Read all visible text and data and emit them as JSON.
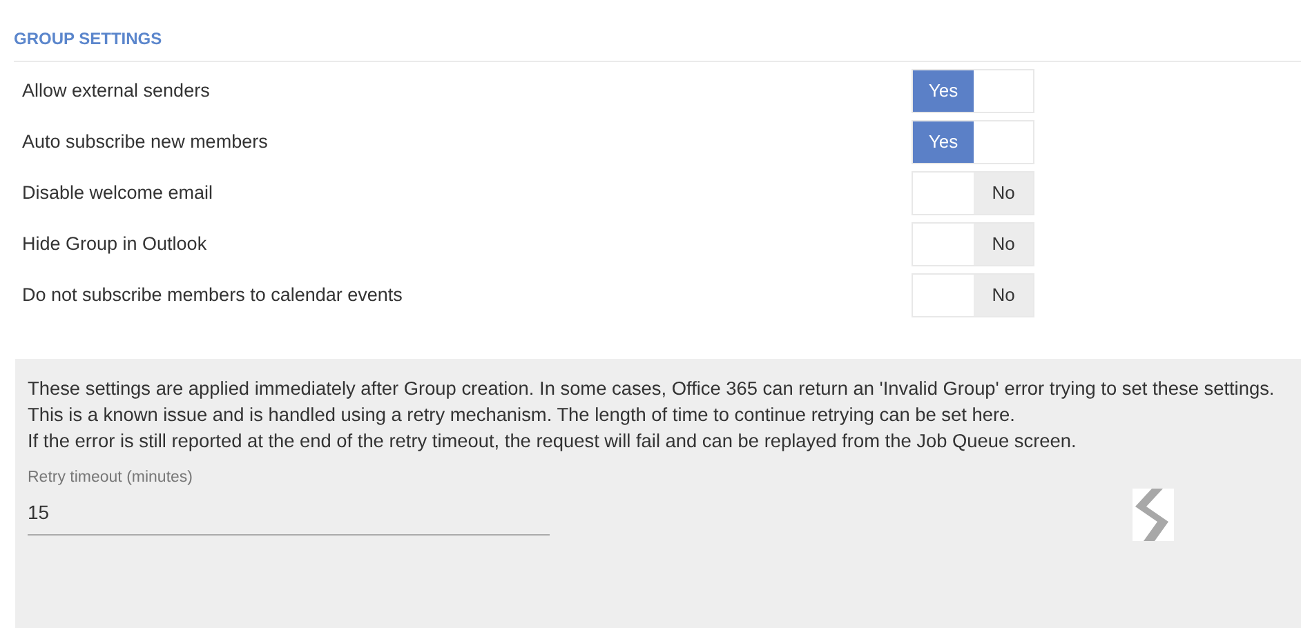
{
  "section_title": "GROUP SETTINGS",
  "settings": [
    {
      "label": "Allow external senders",
      "on": true,
      "state_label": "Yes"
    },
    {
      "label": "Auto subscribe new members",
      "on": true,
      "state_label": "Yes"
    },
    {
      "label": "Disable welcome email",
      "on": false,
      "state_label": "No"
    },
    {
      "label": "Hide Group in Outlook",
      "on": false,
      "state_label": "No"
    },
    {
      "label": "Do not subscribe members to calendar events",
      "on": false,
      "state_label": "No"
    }
  ],
  "retry_panel": {
    "description_lines": [
      "These settings are applied immediately after Group creation. In some cases, Office 365 can return an 'Invalid Group' error trying to set these settings.",
      "This is a known issue and is handled using a retry mechanism. The length of time to continue retrying can be set here.",
      "If the error is still reported at the end of the retry timeout, the request will fail and can be replayed from the Job Queue screen."
    ],
    "field": {
      "label": "Retry timeout (minutes)",
      "value": "15"
    }
  }
}
